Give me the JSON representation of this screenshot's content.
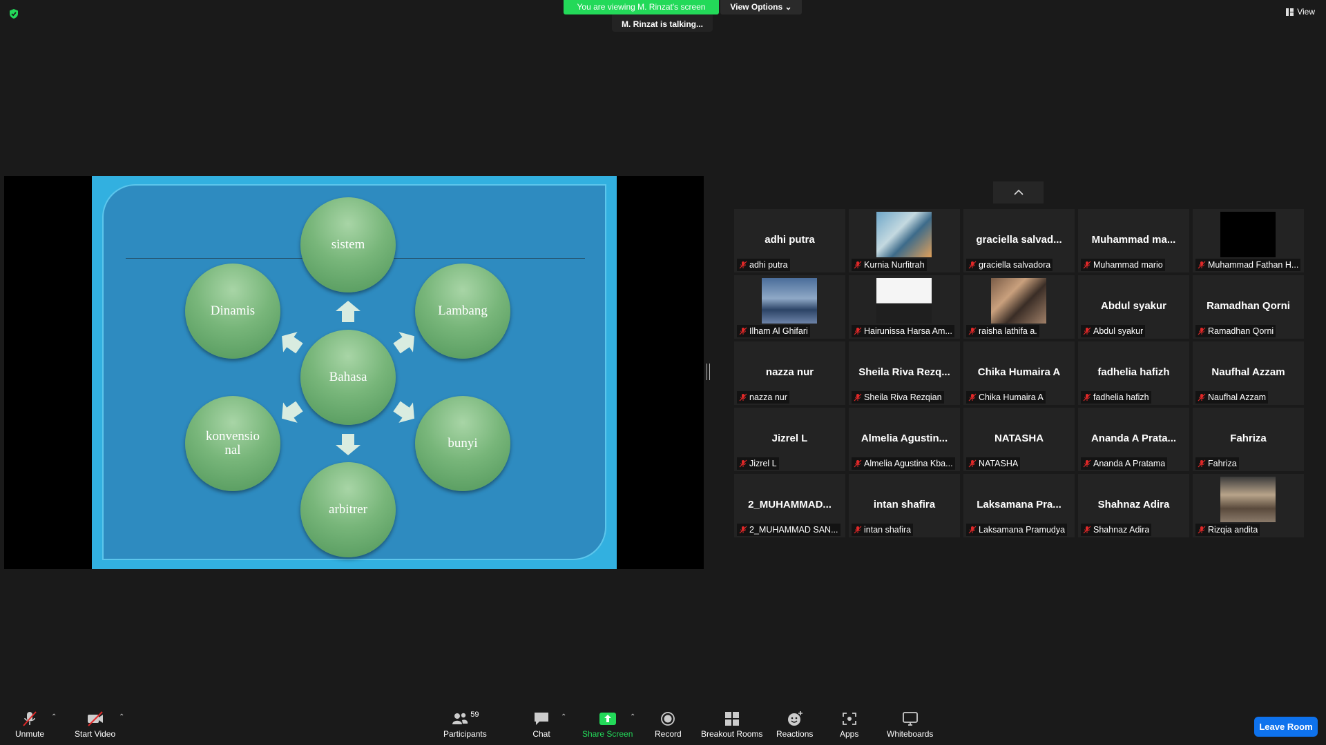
{
  "top": {
    "viewing_banner": "You are viewing M. Rinzat's screen",
    "view_options": "View Options",
    "talking": "M. Rinzat is talking...",
    "view_label": "View"
  },
  "slide": {
    "center": "Bahasa",
    "bubbles": [
      "sistem",
      "Lambang",
      "bunyi",
      "arbitrer",
      "konvensio nal",
      "Dinamis"
    ]
  },
  "participants": [
    {
      "big": "adhi putra",
      "name": "adhi putra"
    },
    {
      "big": "",
      "name": "Kurnia Nurfitrah",
      "thumb": "photo-1"
    },
    {
      "big": "graciella  salvad...",
      "name": "graciella salvadora"
    },
    {
      "big": "Muhammad  ma...",
      "name": "Muhammad mario"
    },
    {
      "big": "",
      "name": "Muhammad Fathan H...",
      "thumb": "black"
    },
    {
      "big": "",
      "name": "Ilham Al Ghifari",
      "thumb": "photo-2"
    },
    {
      "big": "",
      "name": "Hairunissa Harsa Am...",
      "thumb": "photo-3"
    },
    {
      "big": "",
      "name": "raisha lathifa a.",
      "thumb": "photo-4"
    },
    {
      "big": "Abdul syakur",
      "name": "Abdul syakur"
    },
    {
      "big": "Ramadhan Qorni",
      "name": "Ramadhan Qorni"
    },
    {
      "big": "nazza nur",
      "name": "nazza nur"
    },
    {
      "big": "Sheila  Riva  Rezq...",
      "name": "Sheila Riva Rezqian"
    },
    {
      "big": "Chika Humaira A",
      "name": "Chika Humaira A"
    },
    {
      "big": "fadhelia hafizh",
      "name": "fadhelia hafizh"
    },
    {
      "big": "Naufhal Azzam",
      "name": "Naufhal Azzam"
    },
    {
      "big": "Jizrel L",
      "name": "Jizrel L"
    },
    {
      "big": "Almelia  Agustin...",
      "name": "Almelia Agustina Kba..."
    },
    {
      "big": "NATASHA",
      "name": "NATASHA"
    },
    {
      "big": "Ananda  A  Prata...",
      "name": "Ananda A Pratama"
    },
    {
      "big": "Fahriza",
      "name": "Fahriza"
    },
    {
      "big": "2_MUHAMMAD...",
      "name": "2_MUHAMMAD SAN..."
    },
    {
      "big": "intan shafira",
      "name": "intan shafira"
    },
    {
      "big": "Laksamana  Pra...",
      "name": "Laksamana Pramudya"
    },
    {
      "big": "Shahnaz Adira",
      "name": "Shahnaz Adira"
    },
    {
      "big": "",
      "name": "Rizqia andita",
      "thumb": "photo-5"
    }
  ],
  "toolbar": {
    "unmute": "Unmute",
    "start_video": "Start Video",
    "participants": "Participants",
    "participant_count": "59",
    "chat": "Chat",
    "share_screen": "Share Screen",
    "record": "Record",
    "breakout_rooms": "Breakout Rooms",
    "reactions": "Reactions",
    "apps": "Apps",
    "whiteboards": "Whiteboards",
    "leave_room": "Leave Room"
  },
  "colors": {
    "share_green": "#23d959",
    "leave_blue": "#0e72ed",
    "mute_red": "#e02828"
  }
}
